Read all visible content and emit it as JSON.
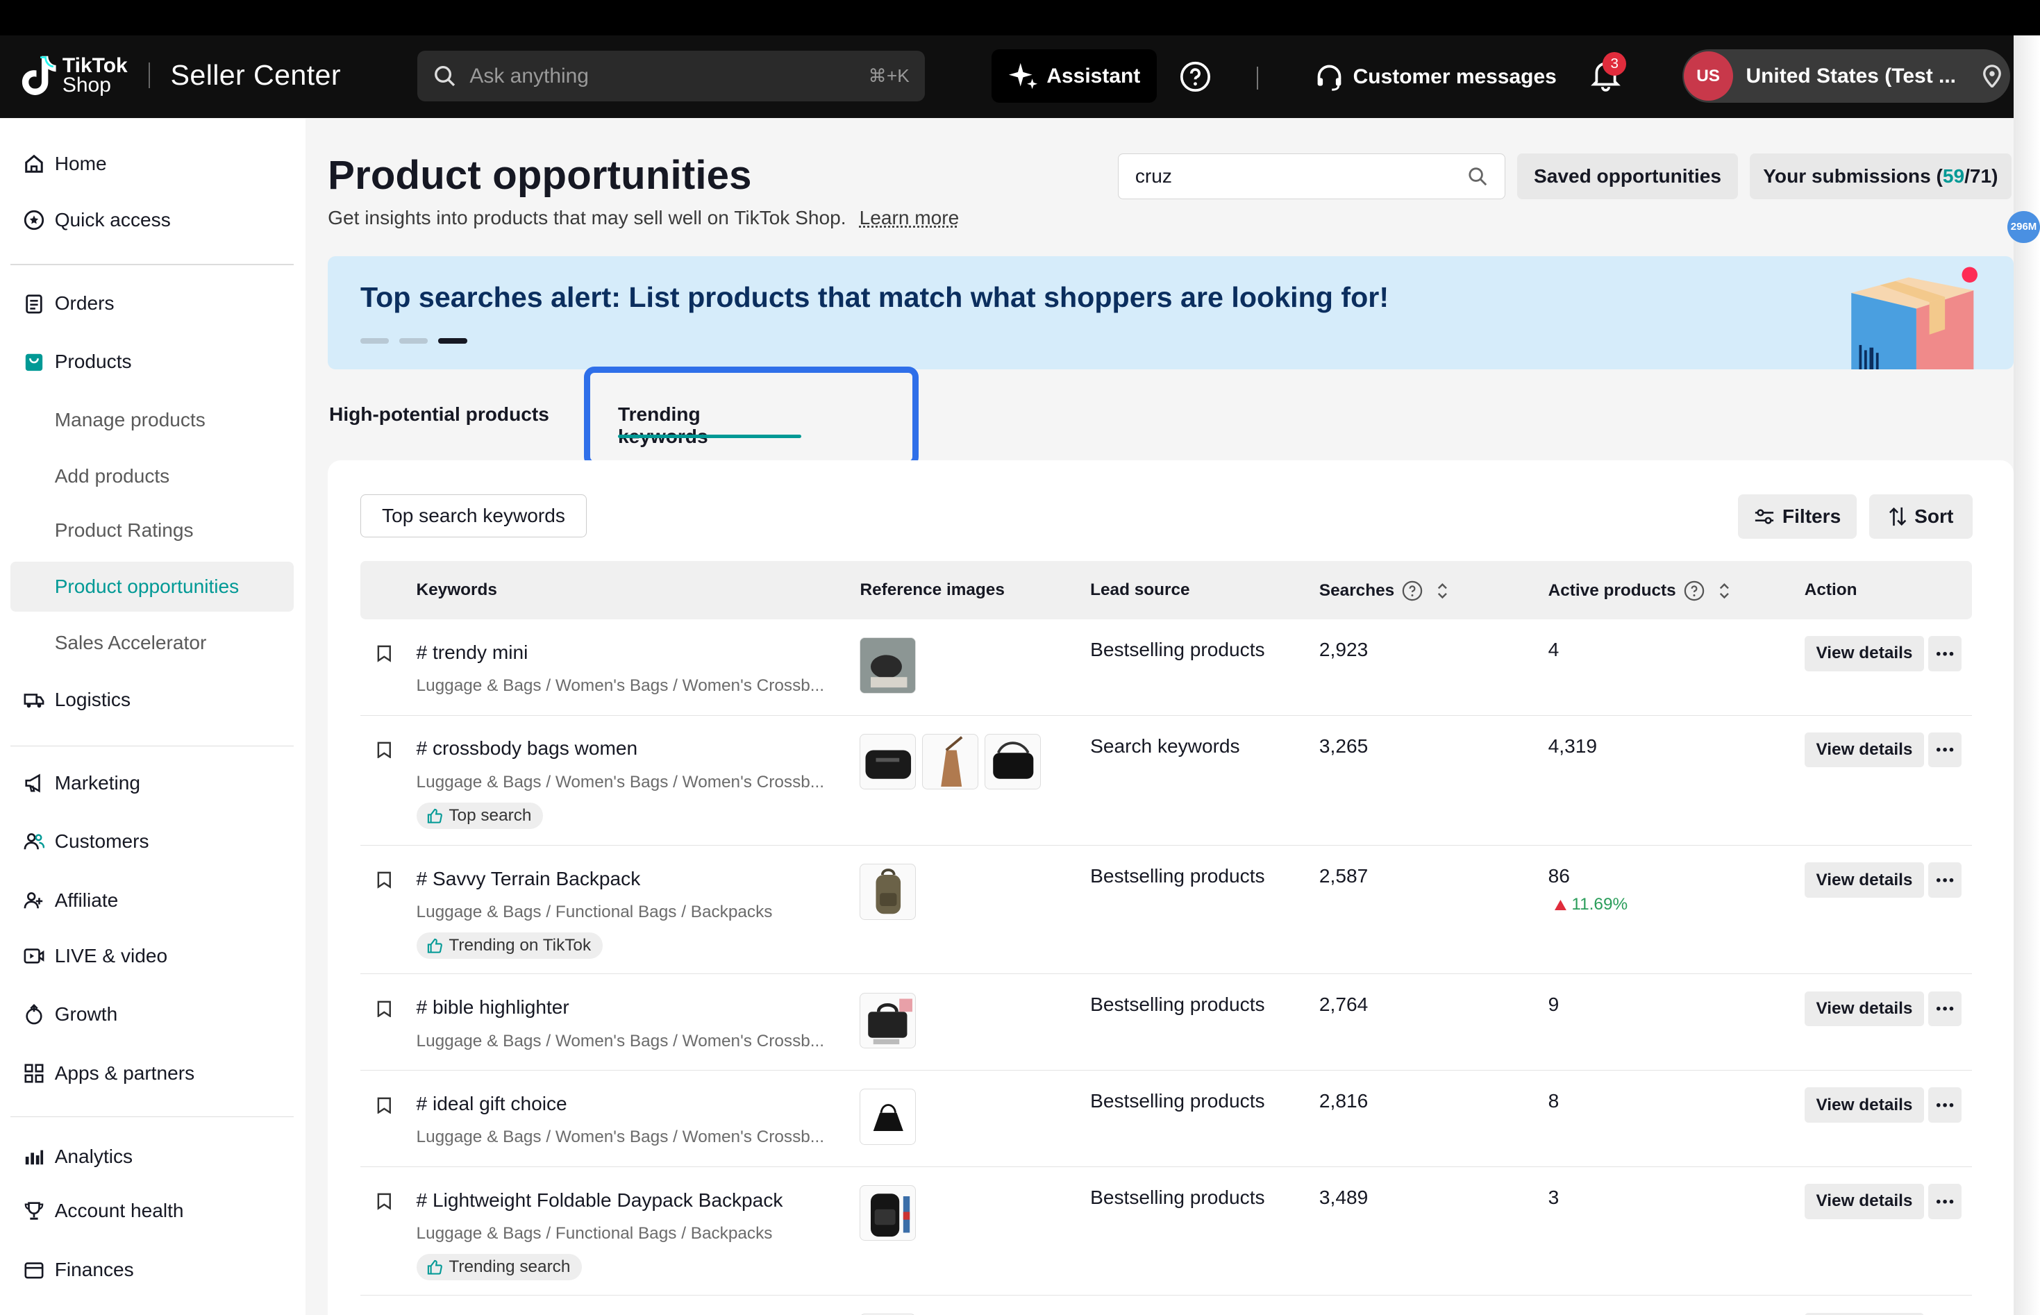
{
  "header": {
    "brand_line1": "TikTok",
    "brand_line2": "Shop",
    "app_title": "Seller Center",
    "search_placeholder": "Ask anything",
    "search_shortcut": "⌘+K",
    "assistant_label": "Assistant",
    "customer_messages_label": "Customer messages",
    "notification_count": "3",
    "region_avatar": "US",
    "region_label": "United States (Test ..."
  },
  "sidebar": {
    "items": [
      {
        "label": "Home",
        "icon": "home-icon"
      },
      {
        "label": "Quick access",
        "icon": "star-icon"
      },
      {
        "label": "Orders",
        "icon": "clipboard-icon"
      },
      {
        "label": "Products",
        "icon": "bag-icon"
      },
      {
        "label": "Manage products"
      },
      {
        "label": "Add products"
      },
      {
        "label": "Product Ratings"
      },
      {
        "label": "Product opportunities",
        "active": true
      },
      {
        "label": "Sales Accelerator"
      },
      {
        "label": "Logistics",
        "icon": "truck-icon"
      },
      {
        "label": "Marketing",
        "icon": "megaphone-icon"
      },
      {
        "label": "Customers",
        "icon": "users-icon"
      },
      {
        "label": "Affiliate",
        "icon": "affiliate-icon"
      },
      {
        "label": "LIVE & video",
        "icon": "video-icon"
      },
      {
        "label": "Growth",
        "icon": "growth-icon"
      },
      {
        "label": "Apps & partners",
        "icon": "apps-icon"
      },
      {
        "label": "Analytics",
        "icon": "analytics-icon"
      },
      {
        "label": "Account health",
        "icon": "trophy-icon"
      },
      {
        "label": "Finances",
        "icon": "wallet-icon"
      }
    ]
  },
  "page": {
    "title": "Product opportunities",
    "subtitle": "Get insights into products that may sell well on TikTok Shop.",
    "learn_more": "Learn more",
    "search_value": "cruz",
    "saved_label": "Saved opportunities",
    "submissions_label": "Your submissions (",
    "submissions_done": "59",
    "submissions_total": "/71)"
  },
  "banner": {
    "text": "Top searches alert: List products that match what shoppers are looking for!"
  },
  "tabs": {
    "tab1": "High-potential products",
    "tab2": "Trending keywords"
  },
  "toolbar": {
    "top_search": "Top search keywords",
    "filters": "Filters",
    "sort": "Sort"
  },
  "table": {
    "columns": {
      "keywords": "Keywords",
      "reference_images": "Reference images",
      "lead_source": "Lead source",
      "searches": "Searches",
      "active_products": "Active products",
      "action": "Action"
    },
    "view_details": "View details",
    "rows": [
      {
        "keyword": "# trendy mini",
        "category": "Luggage & Bags / Women's Bags / Women's Crossb...",
        "lead": "Bestselling products",
        "searches": "2,923",
        "active": "4"
      },
      {
        "keyword": "# crossbody bags women",
        "category": "Luggage & Bags / Women's Bags / Women's Crossb...",
        "tag": "Top search",
        "lead": "Search keywords",
        "searches": "3,265",
        "active": "4,319"
      },
      {
        "keyword": "# Savvy Terrain Backpack",
        "category": "Luggage & Bags / Functional Bags / Backpacks",
        "tag": "Trending on TikTok",
        "lead": "Bestselling products",
        "searches": "2,587",
        "active": "86",
        "change": "11.69%"
      },
      {
        "keyword": "# bible highlighter",
        "category": "Luggage & Bags / Women's Bags / Women's Crossb...",
        "lead": "Bestselling products",
        "searches": "2,764",
        "active": "9"
      },
      {
        "keyword": "# ideal gift choice",
        "category": "Luggage & Bags / Women's Bags / Women's Crossb...",
        "lead": "Bestselling products",
        "searches": "2,816",
        "active": "8"
      },
      {
        "keyword": "# Lightweight Foldable Daypack Backpack",
        "category": "Luggage & Bags / Functional Bags / Backpacks",
        "tag": "Trending search",
        "lead": "Bestselling products",
        "searches": "3,489",
        "active": "3"
      }
    ]
  },
  "floating_badge": "296M",
  "colors": {
    "accent": "#009995",
    "highlight": "#2f6fe9",
    "banner": "#d6ecfa",
    "header": "#0f0f0f"
  }
}
